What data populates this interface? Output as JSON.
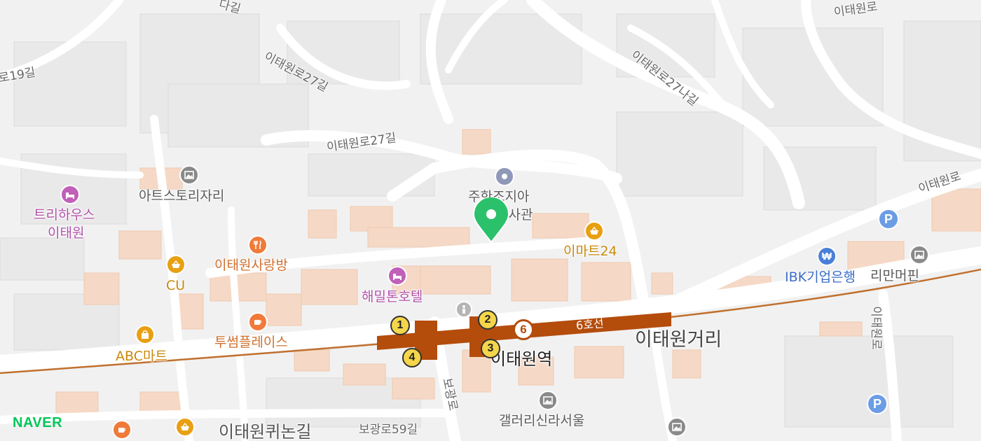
{
  "map": {
    "brand": "NAVER",
    "colors": {
      "line6": "#b44c0b",
      "marker": "#2bc16b",
      "shop": "#e8a013",
      "food": "#f07a3a",
      "hotel": "#c060b8",
      "culture": "#8a8a8a",
      "bank": "#4a7fd8",
      "parking": "#6b9ce6"
    },
    "roads": {
      "r1": "로19길",
      "r2": "이태원로27길",
      "r3": "이태원로27길",
      "r4": "이태원로27나길",
      "r5": "이태원로",
      "r6": "이태원로",
      "r7": "보광로",
      "r8": "보광로59길",
      "r9": "다길",
      "r10": "이태원로"
    },
    "subway": {
      "line_label": "6호선",
      "line_number": "6",
      "station": "이태원역",
      "exits": [
        "1",
        "2",
        "3",
        "4"
      ]
    },
    "places": {
      "triehouse_1": "트리하우스",
      "triehouse_2": "이태원",
      "artstory": "아트스토리자리",
      "sarangbang": "이태원사랑방",
      "cu": "CU",
      "abcmart": "ABC마트",
      "twosome": "투썸플레이스",
      "hamilton": "해밀톤호텔",
      "georgia_1": "주한조지아",
      "georgia_2": "대사관",
      "emart24": "이마트24",
      "ibk": "IBK기업은행",
      "rimanmerfin": "리만머핀",
      "itaewon_street": "이태원거리",
      "gallery_shilla": "갤러리신라서울",
      "itaewon_kinogil": "이태원퀴논길"
    },
    "parking_label": "P",
    "bank_symbol": "₩"
  }
}
